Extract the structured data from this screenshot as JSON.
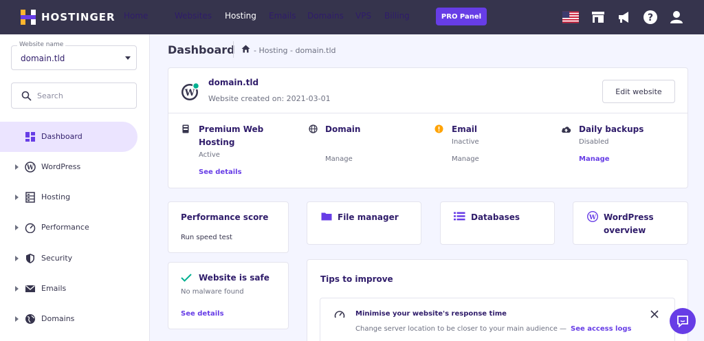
{
  "brand": {
    "name": "HOSTINGER"
  },
  "nav": {
    "items": [
      {
        "label": "Home",
        "active": false
      },
      {
        "label": "Websites",
        "active": false
      },
      {
        "label": "Hosting",
        "active": true
      },
      {
        "label": "Emails",
        "active": false
      },
      {
        "label": "Domains",
        "active": false
      },
      {
        "label": "VPS",
        "active": false
      },
      {
        "label": "Billing",
        "active": false
      }
    ],
    "pro_panel": "PRO Panel",
    "icons": [
      "us-flag-icon",
      "store-icon",
      "megaphone-icon",
      "help-icon",
      "user-icon"
    ]
  },
  "sidebar": {
    "site_select": {
      "label": "Website name",
      "value": "domain.tld"
    },
    "search": {
      "placeholder": "Search"
    },
    "items": [
      {
        "label": "Dashboard",
        "icon": "dashboard-icon",
        "active": true
      },
      {
        "label": "WordPress",
        "icon": "wordpress-icon",
        "active": false
      },
      {
        "label": "Hosting",
        "icon": "server-icon",
        "active": false
      },
      {
        "label": "Performance",
        "icon": "gauge-icon",
        "active": false
      },
      {
        "label": "Security",
        "icon": "shield-icon",
        "active": false
      },
      {
        "label": "Emails",
        "icon": "envelope-icon",
        "active": false
      },
      {
        "label": "Domains",
        "icon": "globe-icon",
        "active": false
      }
    ]
  },
  "main": {
    "title": "Dashboard",
    "breadcrumb": "- Hosting - domain.tld",
    "site_card": {
      "domain": "domain.tld",
      "created": "Website created on: 2021-03-01",
      "edit_button": "Edit website",
      "services": [
        {
          "title_line1": "Premium Web",
          "title_line2": "Hosting",
          "status": "Active",
          "action": "See details"
        },
        {
          "title_line1": "Domain",
          "status": "",
          "action": "Manage"
        },
        {
          "title_line1": "Email",
          "status": "Inactive",
          "action": "Manage"
        },
        {
          "title_line1": "Daily backups",
          "status": "Disabled",
          "action": "Manage"
        }
      ]
    },
    "performance": {
      "title": "Performance score",
      "action": "Run speed test"
    },
    "quick_links": [
      {
        "label": "File manager",
        "icon": "folder-icon"
      },
      {
        "label": "Databases",
        "icon": "database-icon"
      },
      {
        "label_line1": "WordPress",
        "label_line2": "overview",
        "icon": "wordpress-icon"
      }
    ],
    "safety": {
      "title": "Website is safe",
      "subtitle": "No malware found",
      "action": "See details"
    },
    "tips": {
      "title": "Tips to improve",
      "item_title": "Minimise your website's response time",
      "item_text": "Change server location to be closer to your main audience —",
      "item_link": "See access logs"
    }
  },
  "colors": {
    "topbar": "#36344d",
    "accent": "#673de6",
    "sidebar_active": "#ebe4ff",
    "warning": "#ffa305",
    "success": "#00b090"
  }
}
